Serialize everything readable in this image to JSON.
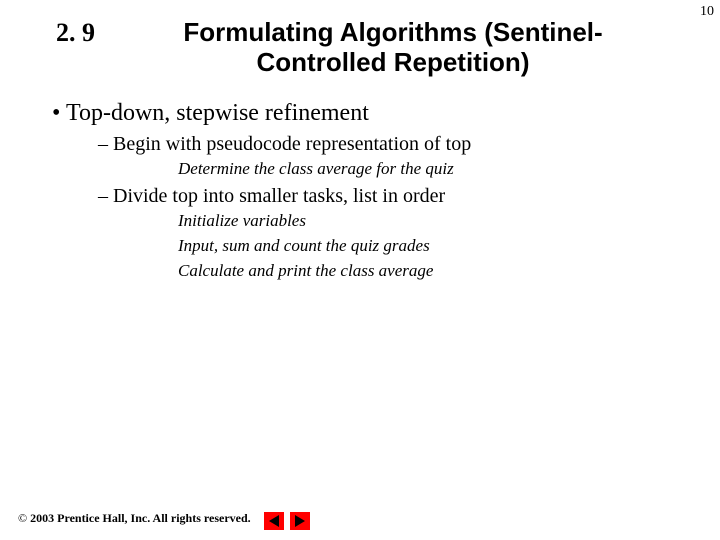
{
  "page_number": "10",
  "section_number": "2. 9",
  "title_line1": "Formulating Algorithms (Sentinel-",
  "title_line2": "Controlled Repetition)",
  "bullet1": "• Top-down, stepwise refinement",
  "sub1": "– Begin with pseudocode representation of top",
  "pseudo1": "Determine the class average for the quiz",
  "sub2": "– Divide top into smaller tasks, list in order",
  "pseudo2": "Initialize variables",
  "pseudo3": "Input, sum and count the quiz grades",
  "pseudo4": "Calculate and print the class average",
  "copyright_symbol": "©",
  "copyright_text": "2003 Prentice Hall, Inc. All rights reserved."
}
